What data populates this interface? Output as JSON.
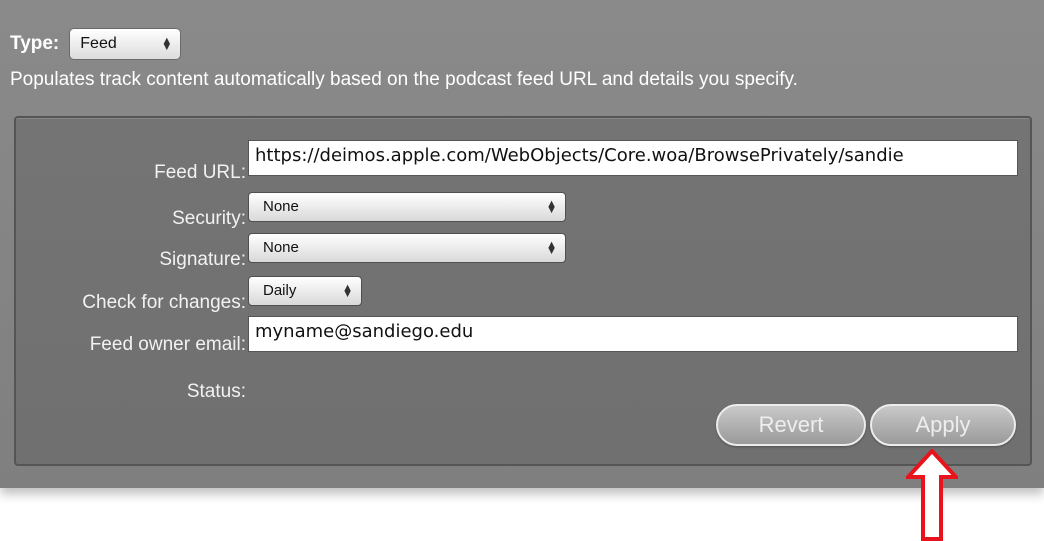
{
  "type_row": {
    "label": "Type:",
    "select_value": "Feed"
  },
  "description": "Populates track content automatically based on the podcast feed URL and details you specify.",
  "form": {
    "feed_url": {
      "label": "Feed URL:",
      "value": "https://deimos.apple.com/WebObjects/Core.woa/BrowsePrivately/sandie"
    },
    "security": {
      "label": "Security:",
      "value": "None"
    },
    "signature": {
      "label": "Signature:",
      "value": "None"
    },
    "check_for_changes": {
      "label": "Check for changes:",
      "value": "Daily"
    },
    "feed_owner_email": {
      "label": "Feed owner email:",
      "value": "myname@sandiego.edu"
    },
    "status": {
      "label": "Status:",
      "value": ""
    }
  },
  "buttons": {
    "revert_label": "Revert",
    "apply_label": "Apply"
  },
  "annotation": {
    "arrow_color": "#e8131b"
  }
}
